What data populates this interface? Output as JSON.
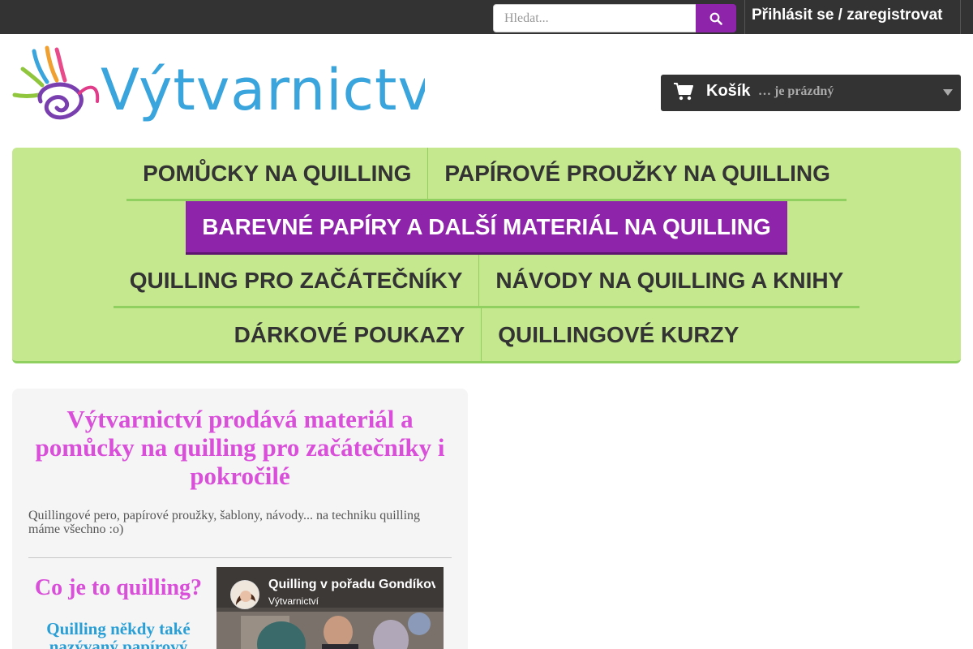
{
  "header": {
    "search": {
      "placeholder": "Hledat...",
      "value": ""
    },
    "login_label": "Přihlásit se / zaregistrovat"
  },
  "logo": {
    "text": "Výtvarnictví"
  },
  "cart": {
    "label": "Košík",
    "status": "… je prázdný"
  },
  "nav": {
    "rows": [
      [
        "POMŮCKY NA QUILLING",
        "PAPÍROVÉ PROUŽKY NA QUILLING"
      ],
      [
        "BAREVNÉ PAPÍRY A DALŠÍ MATERIÁL NA QUILLING"
      ],
      [
        "QUILLING PRO ZAČÁTEČNÍKY",
        "NÁVODY NA QUILLING A KNIHY"
      ],
      [
        "DÁRKOVÉ POUKAZY",
        "QUILLINGOVÉ KURZY"
      ]
    ],
    "active": "BAREVNÉ PAPÍRY A DALŠÍ MATERIÁL NA QUILLING"
  },
  "main": {
    "title": "Výtvarnictví prodává materiál a pomůcky na quilling pro začátečníky i pokročilé",
    "subtitle": "Quillingové pero, papírové proužky, šablony, návody... na techniku quilling máme všechno :o)",
    "section_title": "Co je to quilling?",
    "section_text": "Quilling někdy také nazývaný papírový"
  },
  "video": {
    "title": "Quilling v pořadu Gondíkovi",
    "channel": "Výtvarnictví"
  },
  "colors": {
    "topbar": "#333333",
    "accent": "#8e24aa",
    "nav_bg": "#c5e88f",
    "nav_border": "#8fd060",
    "heading_pink": "#d94fd9",
    "text_blue": "#2a9fd6"
  }
}
